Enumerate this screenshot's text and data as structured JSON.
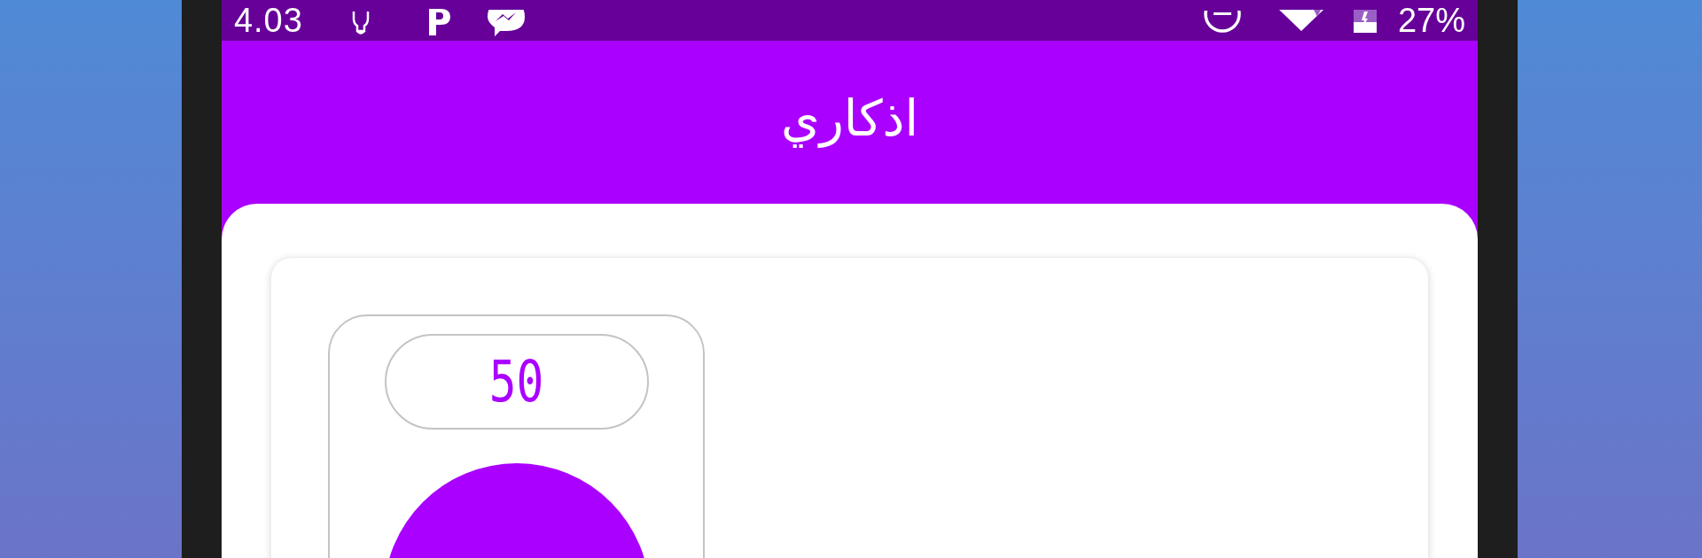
{
  "status_bar": {
    "time": "4.03",
    "battery": "27%"
  },
  "app_bar": {
    "title": "اذكاري"
  },
  "counter": {
    "value": "50"
  }
}
